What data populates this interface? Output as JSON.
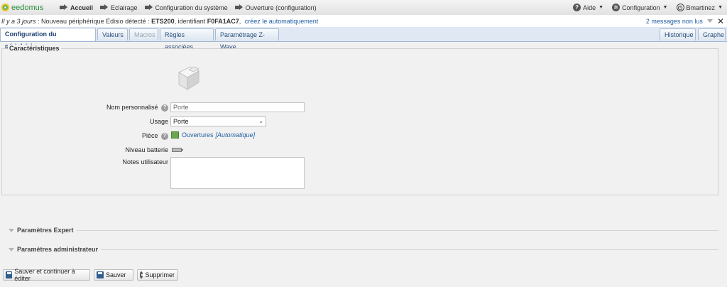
{
  "brand": {
    "name": "eedomus"
  },
  "breadcrumb": [
    {
      "label": "Accueil"
    },
    {
      "label": "Eclairage"
    },
    {
      "label": "Configuration du système"
    },
    {
      "label": "Ouverture (configuration)"
    }
  ],
  "header_right": {
    "help": "Aide",
    "config": "Configuration",
    "user": "Bmartinez"
  },
  "notification": {
    "time": "Il y a 3 jours",
    "text_before": " : Nouveau périphérique Edisio détecté : ",
    "device_code": "ETS200",
    "text_middle": ", identifiant ",
    "device_id": "F0FA1AC7",
    "text_after": ", ",
    "link": "créez le automatiquement",
    "messages": "2 messages non lus"
  },
  "tabs": {
    "config": "Configuration du périphérique",
    "values": "Valeurs",
    "macros": "Macros",
    "rules": "Règles associées",
    "zwave": "Paramétrage Z-Wave",
    "history": "Historique",
    "graph": "Graphe"
  },
  "form": {
    "legend": "Caractéristiques",
    "name_label": "Nom personnalisé",
    "name_value": "Porte",
    "usage_label": "Usage",
    "usage_value": "Porte",
    "room_label": "Pièce",
    "room_value": "Ouvertures",
    "room_auto": "[Automatique]",
    "battery_label": "Niveau batterie",
    "notes_label": "Notes utilisateur"
  },
  "sections": {
    "expert": "Paramètres Expert",
    "admin": "Paramètres administrateur"
  },
  "buttons": {
    "save_continue": "Sauver et continuer à éditer",
    "save": "Sauver",
    "delete": "Supprimer"
  }
}
